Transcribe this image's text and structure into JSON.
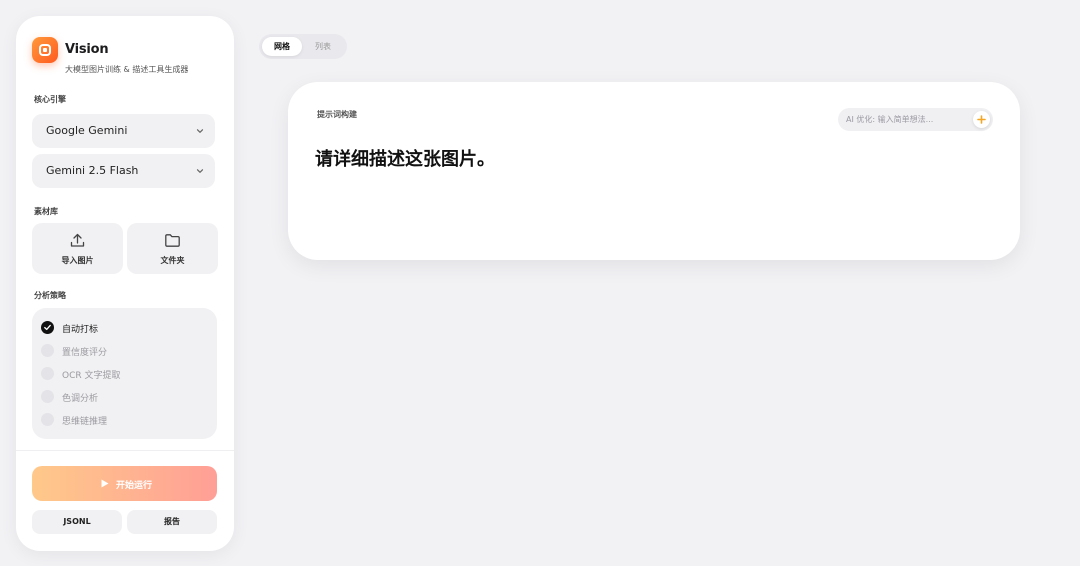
{
  "app": {
    "title": "Vision",
    "subtitle": "大模型图片训练 & 描述工具生成器"
  },
  "sidebar": {
    "engine_label": "核心引擎",
    "provider": "Google Gemini",
    "model": "Gemini 2.5 Flash",
    "library_label": "素材库",
    "import_label": "导入图片",
    "folder_label": "文件夹",
    "strategy_label": "分析策略",
    "options": [
      {
        "label": "自动打标",
        "checked": true
      },
      {
        "label": "置信度评分",
        "checked": false
      },
      {
        "label": "OCR 文字提取",
        "checked": false
      },
      {
        "label": "色调分析",
        "checked": false
      },
      {
        "label": "思维链推理",
        "checked": false
      }
    ],
    "run_label": "开始运行",
    "jsonl_label": "JSONL",
    "report_label": "报告"
  },
  "view_toggle": {
    "grid": "网格",
    "list": "列表"
  },
  "prompt_card": {
    "label": "提示词构建",
    "prompt": "请详细描述这张图片。",
    "ai_placeholder": "AI 优化: 输入简单想法...",
    "ai_value": ""
  },
  "colors": {
    "accent_start": "#ff9a3c",
    "accent_end": "#ff5a1f",
    "run_gradient_start": "#ffc98a",
    "run_gradient_end": "#ff9f96",
    "plus_icon": "#f5a623"
  },
  "icons": {
    "logo": "vision-logo-icon",
    "dropdown": "chevron-down-icon",
    "import": "upload-icon",
    "folder": "folder-icon",
    "check": "check-icon",
    "play": "play-icon",
    "add": "plus-icon"
  }
}
